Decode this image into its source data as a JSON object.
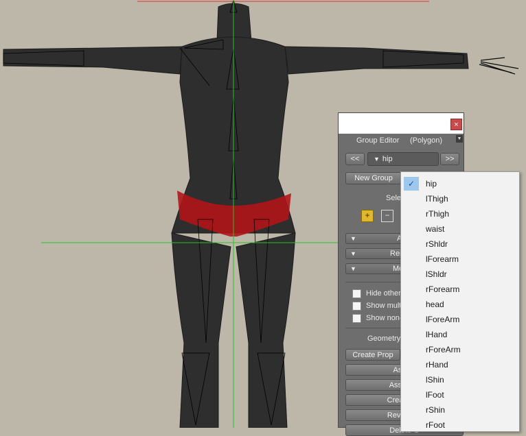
{
  "panel": {
    "title": "Group Editor",
    "mode": "(Polygon)",
    "close_label": "×",
    "menu_icon": "chevron-down-icon",
    "prev_label": "<<",
    "next_label": ">>",
    "group_selected": "hip",
    "new_group_label": "New Group",
    "select_label": "Sele",
    "sections": [
      "A",
      "Ren",
      "Mo"
    ],
    "checkboxes": [
      "Hide other",
      "Show mult",
      "Show non-"
    ],
    "geometry_label": "Geometry",
    "buttons": [
      "Create Prop",
      "Assign",
      "Assign Sm",
      "Create Pers",
      "Reverse Gr",
      "Delete G"
    ]
  },
  "dropdown": {
    "selected": "hip",
    "items": [
      "hip",
      "lThigh",
      "rThigh",
      "waist",
      "rShldr",
      "lForearm",
      "lShldr",
      "rForearm",
      "head",
      "lForeArm",
      "lHand",
      "rForeArm",
      "rHand",
      "lShin",
      "lFoot",
      "rShin",
      "rFoot"
    ]
  },
  "colors": {
    "background": "#bdb7a9",
    "figure": "#2f2f2f",
    "highlight": "#b0151a",
    "axis_green": "#22c422",
    "axis_red": "#e03030",
    "check_bg": "#9ec7ee"
  }
}
